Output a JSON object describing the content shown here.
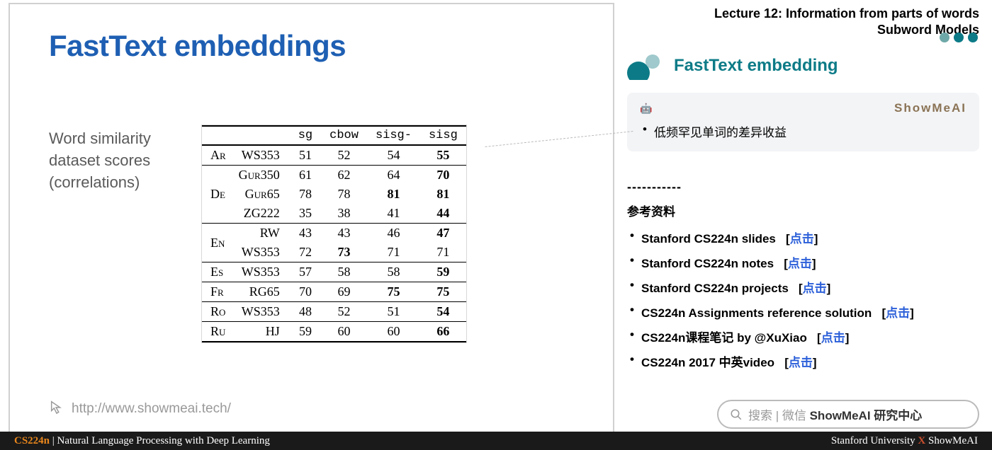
{
  "lecture": {
    "line1": "Lecture 12: Information from parts of words",
    "line2": "Subword Models"
  },
  "slide": {
    "title": "FastText embeddings",
    "subtitle_l1": "Word similarity",
    "subtitle_l2": "dataset scores",
    "subtitle_l3": "(correlations)",
    "url": "http://www.showmeai.tech/"
  },
  "section": {
    "title": "FastText embedding",
    "brand": "ShowMeAI",
    "bullet": "低频罕见单词的差异收益"
  },
  "divider": "-----------",
  "refs": {
    "title": "参考资料",
    "items": [
      {
        "label": "Stanford CS224n slides",
        "link": "点击"
      },
      {
        "label": "Stanford CS224n notes",
        "link": "点击"
      },
      {
        "label": "Stanford CS224n projects",
        "link": "点击"
      },
      {
        "label": "CS224n Assignments reference solution",
        "link": "点击"
      },
      {
        "label": "CS224n课程笔记 by @XuXiao",
        "link": "点击"
      },
      {
        "label": "CS224n 2017 中英video",
        "link": "点击"
      }
    ]
  },
  "search": {
    "placeholder": "搜索 | 微信 ",
    "bold": "ShowMeAI 研究中心"
  },
  "bottom": {
    "course": "CS224n",
    "sep": " | ",
    "subtitle": "Natural Language Processing with Deep Learning",
    "uni": "Stanford University ",
    "x": "X",
    "brand": " ShowMeAI"
  },
  "dots": [
    "#6fa8a8",
    "#0d7b87",
    "#0d7b87"
  ],
  "chart_data": {
    "type": "table",
    "title": "Word similarity dataset scores (correlations)",
    "columns": [
      "sg",
      "cbow",
      "sisg-",
      "sisg"
    ],
    "groups": [
      {
        "lang": "Ar",
        "rows": [
          {
            "ds": "WS353",
            "vals": [
              51,
              52,
              54,
              55
            ],
            "bold": [
              false,
              false,
              false,
              true
            ]
          }
        ]
      },
      {
        "lang": "De",
        "rows": [
          {
            "ds": "Gur350",
            "vals": [
              61,
              62,
              64,
              70
            ],
            "bold": [
              false,
              false,
              false,
              true
            ]
          },
          {
            "ds": "Gur65",
            "vals": [
              78,
              78,
              81,
              81
            ],
            "bold": [
              false,
              false,
              true,
              true
            ]
          },
          {
            "ds": "ZG222",
            "vals": [
              35,
              38,
              41,
              44
            ],
            "bold": [
              false,
              false,
              false,
              true
            ]
          }
        ]
      },
      {
        "lang": "En",
        "rows": [
          {
            "ds": "RW",
            "vals": [
              43,
              43,
              46,
              47
            ],
            "bold": [
              false,
              false,
              false,
              true
            ]
          },
          {
            "ds": "WS353",
            "vals": [
              72,
              73,
              71,
              71
            ],
            "bold": [
              false,
              true,
              false,
              false
            ]
          }
        ]
      },
      {
        "lang": "Es",
        "rows": [
          {
            "ds": "WS353",
            "vals": [
              57,
              58,
              58,
              59
            ],
            "bold": [
              false,
              false,
              false,
              true
            ]
          }
        ]
      },
      {
        "lang": "Fr",
        "rows": [
          {
            "ds": "RG65",
            "vals": [
              70,
              69,
              75,
              75
            ],
            "bold": [
              false,
              false,
              true,
              true
            ]
          }
        ]
      },
      {
        "lang": "Ro",
        "rows": [
          {
            "ds": "WS353",
            "vals": [
              48,
              52,
              51,
              54
            ],
            "bold": [
              false,
              false,
              false,
              true
            ]
          }
        ]
      },
      {
        "lang": "Ru",
        "rows": [
          {
            "ds": "HJ",
            "vals": [
              59,
              60,
              60,
              66
            ],
            "bold": [
              false,
              false,
              false,
              true
            ]
          }
        ]
      }
    ]
  }
}
